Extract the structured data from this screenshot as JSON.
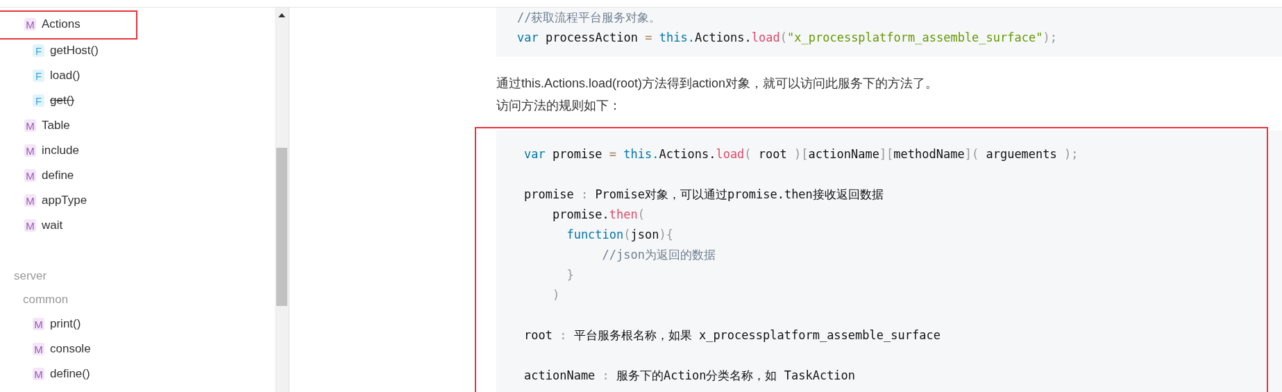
{
  "sidebar": {
    "items": [
      {
        "badge": "M",
        "label": "Actions",
        "highlighted": true,
        "deprecated": false,
        "children": [
          {
            "badge": "F",
            "label": "getHost()",
            "highlighted": false,
            "deprecated": false
          },
          {
            "badge": "F",
            "label": "load()",
            "highlighted": false,
            "deprecated": false
          },
          {
            "badge": "F",
            "label": "get()",
            "highlighted": false,
            "deprecated": true
          }
        ]
      },
      {
        "badge": "M",
        "label": "Table",
        "highlighted": false,
        "deprecated": false
      },
      {
        "badge": "M",
        "label": "include",
        "highlighted": false,
        "deprecated": false
      },
      {
        "badge": "M",
        "label": "define",
        "highlighted": false,
        "deprecated": false
      },
      {
        "badge": "M",
        "label": "appType",
        "highlighted": false,
        "deprecated": false
      },
      {
        "badge": "M",
        "label": "wait",
        "highlighted": false,
        "deprecated": false
      }
    ],
    "groups": [
      {
        "label": "server",
        "children": [
          {
            "label": "common",
            "items": [
              {
                "badge": "M",
                "label": "print()",
                "highlighted": false,
                "deprecated": false
              },
              {
                "badge": "M",
                "label": "console",
                "highlighted": false,
                "deprecated": false
              },
              {
                "badge": "M",
                "label": "define()",
                "highlighted": false,
                "deprecated": false
              }
            ]
          }
        ]
      }
    ]
  },
  "content": [
    {
      "kind": "code",
      "highlighted": false,
      "lines": [
        {
          "blank_before": false,
          "tokens": [
            {
              "color": "#708090",
              "t": "//获取流程平台服务对象。"
            }
          ]
        },
        {
          "blank_before": false,
          "tokens": [
            {
              "color": "#0077aa",
              "t": "var"
            },
            {
              "color": "#111111",
              "t": " processAction "
            },
            {
              "color": "#a67f59",
              "t": "="
            },
            {
              "color": "#0077aa",
              "t": " this."
            },
            {
              "color": "#111111",
              "t": "Actions."
            },
            {
              "color": "#dd4a68",
              "t": "load"
            },
            {
              "color": "#999999",
              "t": "("
            },
            {
              "color": "#669900",
              "t": "\"x_processplatform_assemble_surface\""
            },
            {
              "color": "#999999",
              "t": ");"
            }
          ]
        }
      ]
    },
    {
      "kind": "paragraph",
      "lines": [
        "通过this.Actions.load(root)方法得到action对象，就可以访问此服务下的方法了。",
        "访问方法的规则如下："
      ]
    },
    {
      "kind": "code",
      "highlighted": true,
      "lines": [
        {
          "blank_before": false,
          "tokens": [
            {
              "color": "#0077aa",
              "t": "var"
            },
            {
              "color": "#111111",
              "t": " promise "
            },
            {
              "color": "#a67f59",
              "t": "="
            },
            {
              "color": "#0077aa",
              "t": " this."
            },
            {
              "color": "#111111",
              "t": "Actions."
            },
            {
              "color": "#dd4a68",
              "t": "load"
            },
            {
              "color": "#999999",
              "t": "("
            },
            {
              "color": "#111111",
              "t": " root "
            },
            {
              "color": "#999999",
              "t": ")["
            },
            {
              "color": "#111111",
              "t": "actionName"
            },
            {
              "color": "#999999",
              "t": "]["
            },
            {
              "color": "#111111",
              "t": "methodName"
            },
            {
              "color": "#999999",
              "t": "]("
            },
            {
              "color": "#111111",
              "t": " arguements "
            },
            {
              "color": "#999999",
              "t": ");"
            }
          ]
        },
        {
          "blank_before": true,
          "tokens": [
            {
              "color": "#111111",
              "t": "promise "
            },
            {
              "color": "#999999",
              "t": ":"
            },
            {
              "color": "#111111",
              "t": " Promise对象，可以通过promise.then接收返回数据"
            }
          ]
        },
        {
          "blank_before": false,
          "tokens": [
            {
              "color": "#111111",
              "t": "    promise."
            },
            {
              "color": "#dd4a68",
              "t": "then"
            },
            {
              "color": "#999999",
              "t": "("
            }
          ]
        },
        {
          "blank_before": false,
          "tokens": [
            {
              "color": "#0077aa",
              "t": "      function"
            },
            {
              "color": "#999999",
              "t": "("
            },
            {
              "color": "#111111",
              "t": "json"
            },
            {
              "color": "#999999",
              "t": "){"
            }
          ]
        },
        {
          "blank_before": false,
          "tokens": [
            {
              "color": "#708090",
              "t": "           //json为返回的数据"
            }
          ]
        },
        {
          "blank_before": false,
          "tokens": [
            {
              "color": "#999999",
              "t": "      }"
            }
          ]
        },
        {
          "blank_before": false,
          "tokens": [
            {
              "color": "#999999",
              "t": "    )"
            }
          ]
        },
        {
          "blank_before": true,
          "tokens": [
            {
              "color": "#111111",
              "t": "root "
            },
            {
              "color": "#999999",
              "t": ":"
            },
            {
              "color": "#111111",
              "t": " 平台服务根名称，如果 x_processplatform_assemble_surface"
            }
          ]
        },
        {
          "blank_before": true,
          "tokens": [
            {
              "color": "#111111",
              "t": "actionName "
            },
            {
              "color": "#999999",
              "t": ":"
            },
            {
              "color": "#111111",
              "t": " 服务下的Action分类名称，如 TaskAction"
            }
          ]
        }
      ]
    }
  ]
}
